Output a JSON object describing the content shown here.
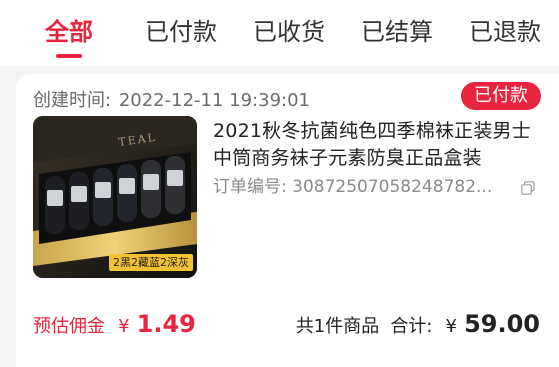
{
  "tabs": [
    {
      "label": "全部",
      "active": true
    },
    {
      "label": "已付款",
      "active": false
    },
    {
      "label": "已收货",
      "active": false
    },
    {
      "label": "已结算",
      "active": false
    },
    {
      "label": "已退款",
      "active": false
    }
  ],
  "order": {
    "created_label": "创建时间:",
    "created_time": "2022-12-11 19:39:01",
    "status": "已付款",
    "title": "2021秋冬抗菌纯色四季棉袜正装男士中筒商务袜子元素防臭正品盒装",
    "order_no_label": "订单编号:",
    "order_no": "30872507058248782...",
    "image_brand": "TEAL",
    "image_tag": "2黑2藏蓝2深灰",
    "commission_label": "预估佣金",
    "commission_currency": "¥",
    "commission_amount": "1.49",
    "item_count": "共1件商品",
    "total_label": "合计:",
    "total_currency": "¥",
    "total_amount": "59.00"
  },
  "colors": {
    "accent": "#e8243f",
    "badge_text": "#ffffff",
    "muted": "#8a8a8a",
    "background": "#f4f4f4"
  }
}
